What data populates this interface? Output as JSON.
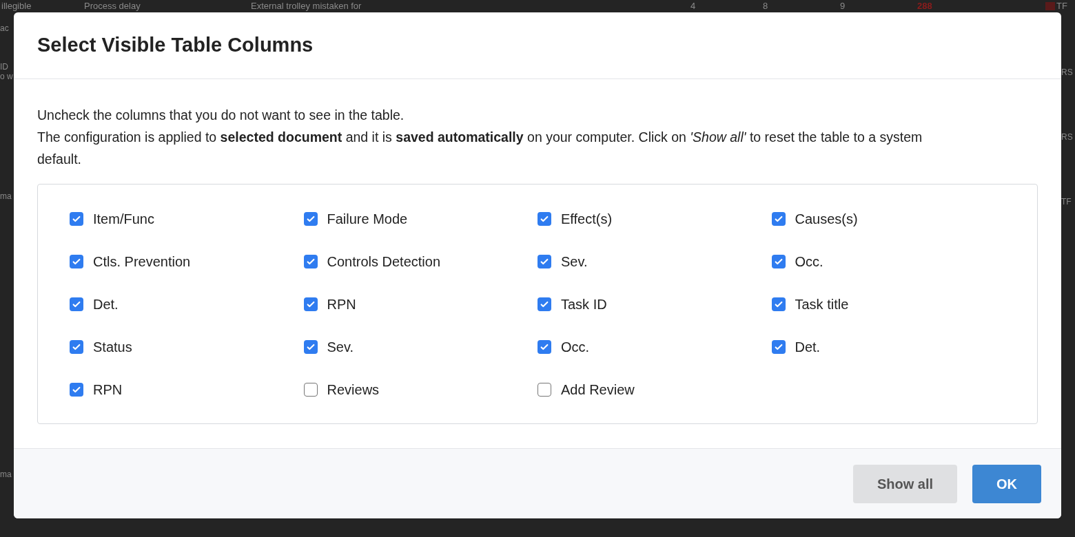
{
  "background_table": {
    "top_row": [
      {
        "text": "illegible"
      },
      {
        "text": "Process delay"
      },
      {
        "text": "External trolley mistaken for"
      },
      {
        "text": "4"
      },
      {
        "text": "8"
      },
      {
        "text": "9"
      },
      {
        "text": "288",
        "color": "#8b1c1c"
      },
      {
        "text": "TF"
      }
    ],
    "left_fragments": [
      "ac",
      "ID",
      "o w",
      "ma",
      "ma"
    ],
    "right_fragments": [
      "RS",
      "RS",
      "TF"
    ]
  },
  "dialog": {
    "title": "Select Visible Table Columns",
    "intro": "Uncheck the columns that you do not want to see in the table.",
    "description": "The configuration is applied to **selected document** and it is **saved automatically** on your computer. Click on *'Show all'* to reset the table to a system default.",
    "columns": [
      {
        "label": "Item/Func",
        "checked": true
      },
      {
        "label": "Failure Mode",
        "checked": true
      },
      {
        "label": "Effect(s)",
        "checked": true
      },
      {
        "label": "Causes(s)",
        "checked": true
      },
      {
        "label": "Ctls. Prevention",
        "checked": true
      },
      {
        "label": "Controls Detection",
        "checked": true
      },
      {
        "label": "Sev.",
        "checked": true
      },
      {
        "label": "Occ.",
        "checked": true
      },
      {
        "label": "Det.",
        "checked": true
      },
      {
        "label": "RPN",
        "checked": true
      },
      {
        "label": "Task ID",
        "checked": true
      },
      {
        "label": "Task title",
        "checked": true
      },
      {
        "label": "Status",
        "checked": true
      },
      {
        "label": "Sev.",
        "checked": true
      },
      {
        "label": "Occ.",
        "checked": true
      },
      {
        "label": "Det.",
        "checked": true
      },
      {
        "label": "RPN",
        "checked": true
      },
      {
        "label": "Reviews",
        "checked": false
      },
      {
        "label": "Add Review",
        "checked": false
      }
    ],
    "buttons": [
      {
        "label": "Show all",
        "kind": "secondary"
      },
      {
        "label": "OK",
        "kind": "primary"
      }
    ]
  }
}
